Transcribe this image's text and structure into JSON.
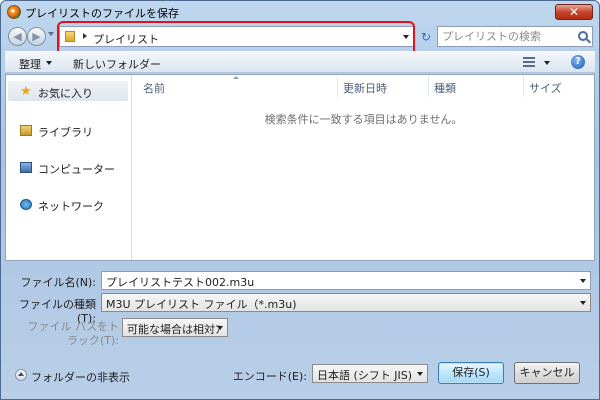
{
  "window": {
    "title": "プレイリストのファイルを保存",
    "close_glyph": "✕"
  },
  "nav": {
    "back_glyph": "◀",
    "forward_glyph": "▶",
    "address_text": "プレイリスト",
    "refresh_glyph": "↻"
  },
  "search": {
    "placeholder": "プレイリストの検索"
  },
  "toolbar": {
    "organize_label": "整理",
    "new_folder_label": "新しいフォルダー",
    "help_glyph": "?"
  },
  "sidebar": {
    "items": [
      {
        "label": "お気に入り",
        "icon": "star-icon"
      },
      {
        "label": "ライブラリ",
        "icon": "library-icon"
      },
      {
        "label": "コンピューター",
        "icon": "computer-icon"
      },
      {
        "label": "ネットワーク",
        "icon": "network-icon"
      }
    ]
  },
  "filelist": {
    "columns": [
      "名前",
      "更新日時",
      "種類",
      "サイズ"
    ],
    "empty_message": "検索条件に一致する項目はありません。"
  },
  "form": {
    "filename_label": "ファイル名(N):",
    "filename_value": "プレイリストテスト002.m3u",
    "filetype_label": "ファイルの種類(T):",
    "filetype_value": "M3U プレイリスト ファイル（*.m3u)",
    "filepath_label_1": "ファイル パスをト",
    "filepath_label_2": "ラック(T):",
    "filepath_value": "可能な場合は相対ﾌ",
    "encode_label": "エンコード(E):",
    "encode_value": "日本語 (シフト JIS)"
  },
  "footer": {
    "hide_folders_label": "フォルダーの非表示",
    "save_label": "保存(S)",
    "cancel_label": "キャンセル"
  },
  "colors": {
    "highlight": "#e2111b",
    "window_frame": "#bfd6ee"
  }
}
